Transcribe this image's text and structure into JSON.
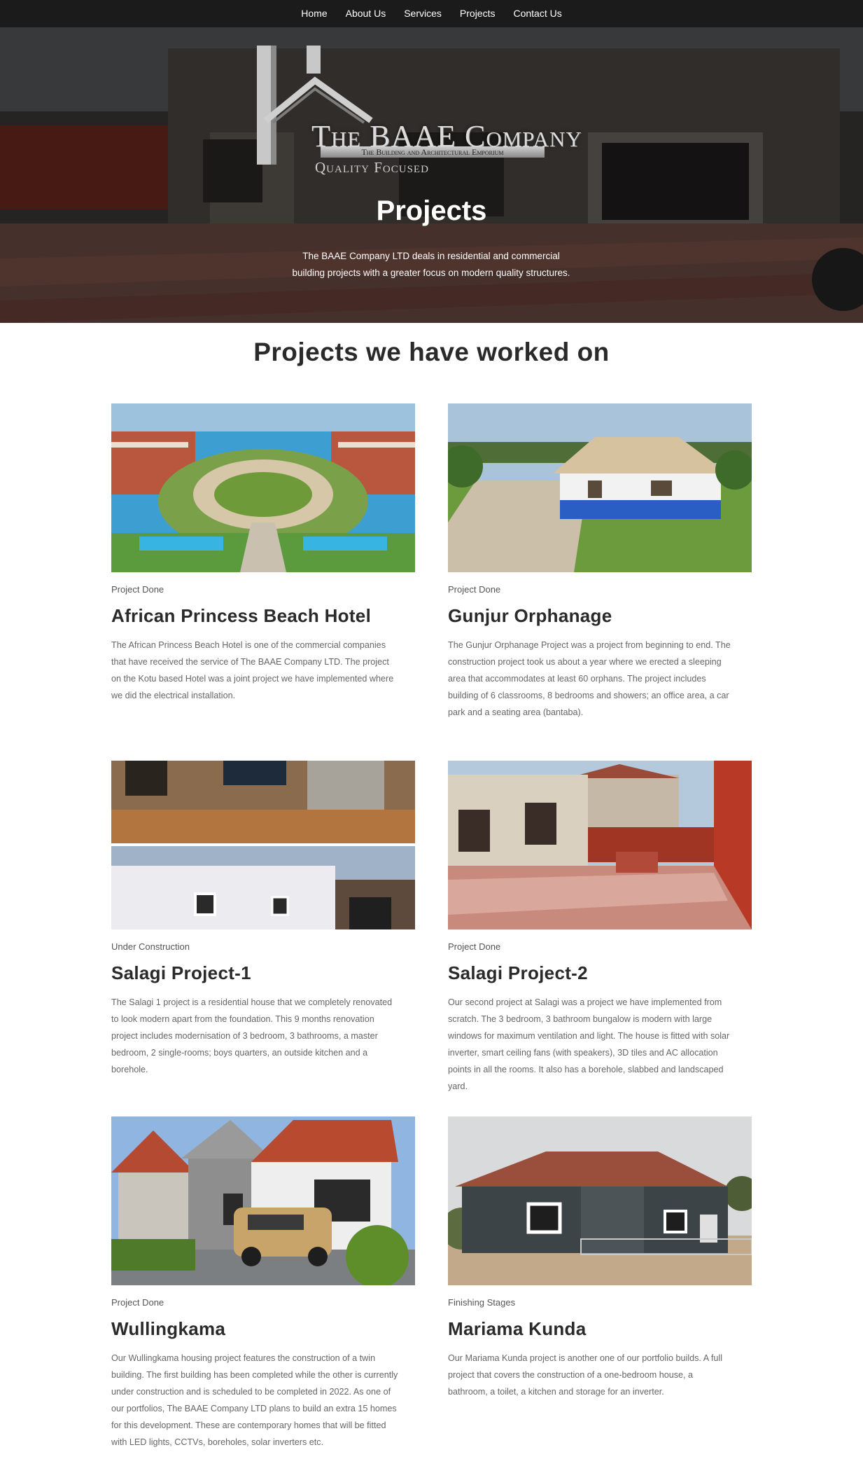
{
  "nav": {
    "items": [
      "Home",
      "About Us",
      "Services",
      "Projects",
      "Contact Us"
    ]
  },
  "hero": {
    "logo_title": "The BAAE Company",
    "logo_subtitle": "The Building and Architectural Emporium",
    "logo_tagline": "Quality Focused",
    "title": "Projects",
    "description": "The BAAE Company LTD deals in residential and commercial building projects with a greater focus on modern quality structures."
  },
  "section": {
    "title": "Projects we have worked on"
  },
  "projects": [
    {
      "status": "Project Done",
      "title": "African Princess Beach Hotel",
      "description": "The African Princess Beach Hotel is one of the commercial companies that have received the service of The BAAE Company LTD. The project on the Kotu based Hotel was a joint project we have implemented where we did the electrical installation."
    },
    {
      "status": "Project Done",
      "title": "Gunjur Orphanage",
      "description": "The Gunjur Orphanage Project was a project from beginning to end. The construction project took us about a year where we erected a sleeping area that accommodates at least 60 orphans. The project includes building of 6 classrooms, 8 bedrooms and showers; an office area, a car park and a seating area (bantaba)."
    },
    {
      "status": "Under Construction",
      "title": "Salagi Project-1",
      "description": "The Salagi 1 project is a residential house that we completely renovated to look modern apart from the foundation. This 9 months renovation project includes modernisation of 3 bedroom, 3 bathrooms, a master bedroom, 2 single-rooms; boys quarters, an outside kitchen and a borehole."
    },
    {
      "status": "Project Done",
      "title": "Salagi Project-2",
      "description": "Our second project at Salagi was a project we have implemented from scratch. The 3 bedroom, 3 bathroom bungalow is modern with large windows for maximum ventilation and light. The house is fitted with solar inverter, smart ceiling fans (with speakers), 3D tiles and AC allocation points in all the rooms. It also has a borehole, slabbed and landscaped yard."
    },
    {
      "status": "Project Done",
      "title": "Wullingkama",
      "description": "Our Wullingkama housing project features the construction of a twin building. The first building has been completed while the other is currently under construction and is scheduled to be completed in 2022. As one of our portfolios, The BAAE Company LTD plans to build an extra 15 homes for this development. These are contemporary homes that will be fitted with LED lights, CCTVs, boreholes, solar inverters etc."
    },
    {
      "status": "Finishing Stages",
      "title": "Mariama Kunda",
      "description": "Our Mariama Kunda project is another one of our portfolio builds. A full project that covers the construction of a one-bedroom house, a bathroom, a toilet, a kitchen and storage for an inverter."
    }
  ]
}
